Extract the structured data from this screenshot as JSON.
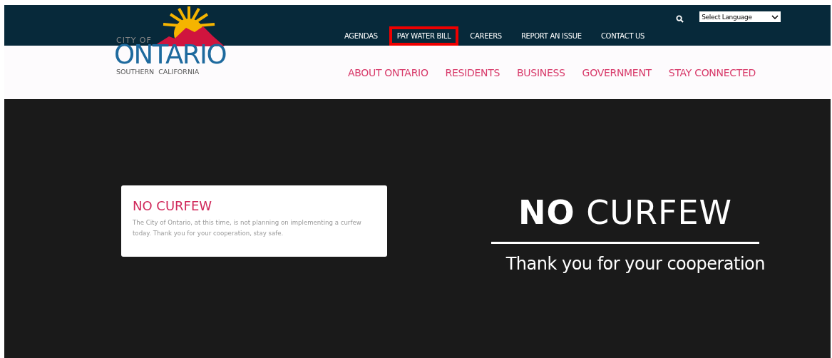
{
  "logo": {
    "top_line": "CITY OF",
    "name": "ONTARIO",
    "tagline": "SOUTHERN  CALIFORNIA"
  },
  "utility_nav": [
    {
      "label": "AGENDAS",
      "highlighted": false
    },
    {
      "label": "PAY WATER BILL",
      "highlighted": true
    },
    {
      "label": "CAREERS",
      "highlighted": false
    },
    {
      "label": "REPORT AN ISSUE",
      "highlighted": false
    },
    {
      "label": "CONTACT US",
      "highlighted": false
    }
  ],
  "language_select": {
    "value": "Select Language"
  },
  "main_nav": [
    "ABOUT ONTARIO",
    "RESIDENTS",
    "BUSINESS",
    "GOVERNMENT",
    "STAY CONNECTED"
  ],
  "alert_card": {
    "title": "NO CURFEW",
    "body": "The City of Ontario, at this time, is not planning on implementing a curfew today. Thank you for your cooperation, stay safe."
  },
  "hero": {
    "headline": "**NO** CURFEW",
    "subline": "Thank you for your cooperation"
  }
}
